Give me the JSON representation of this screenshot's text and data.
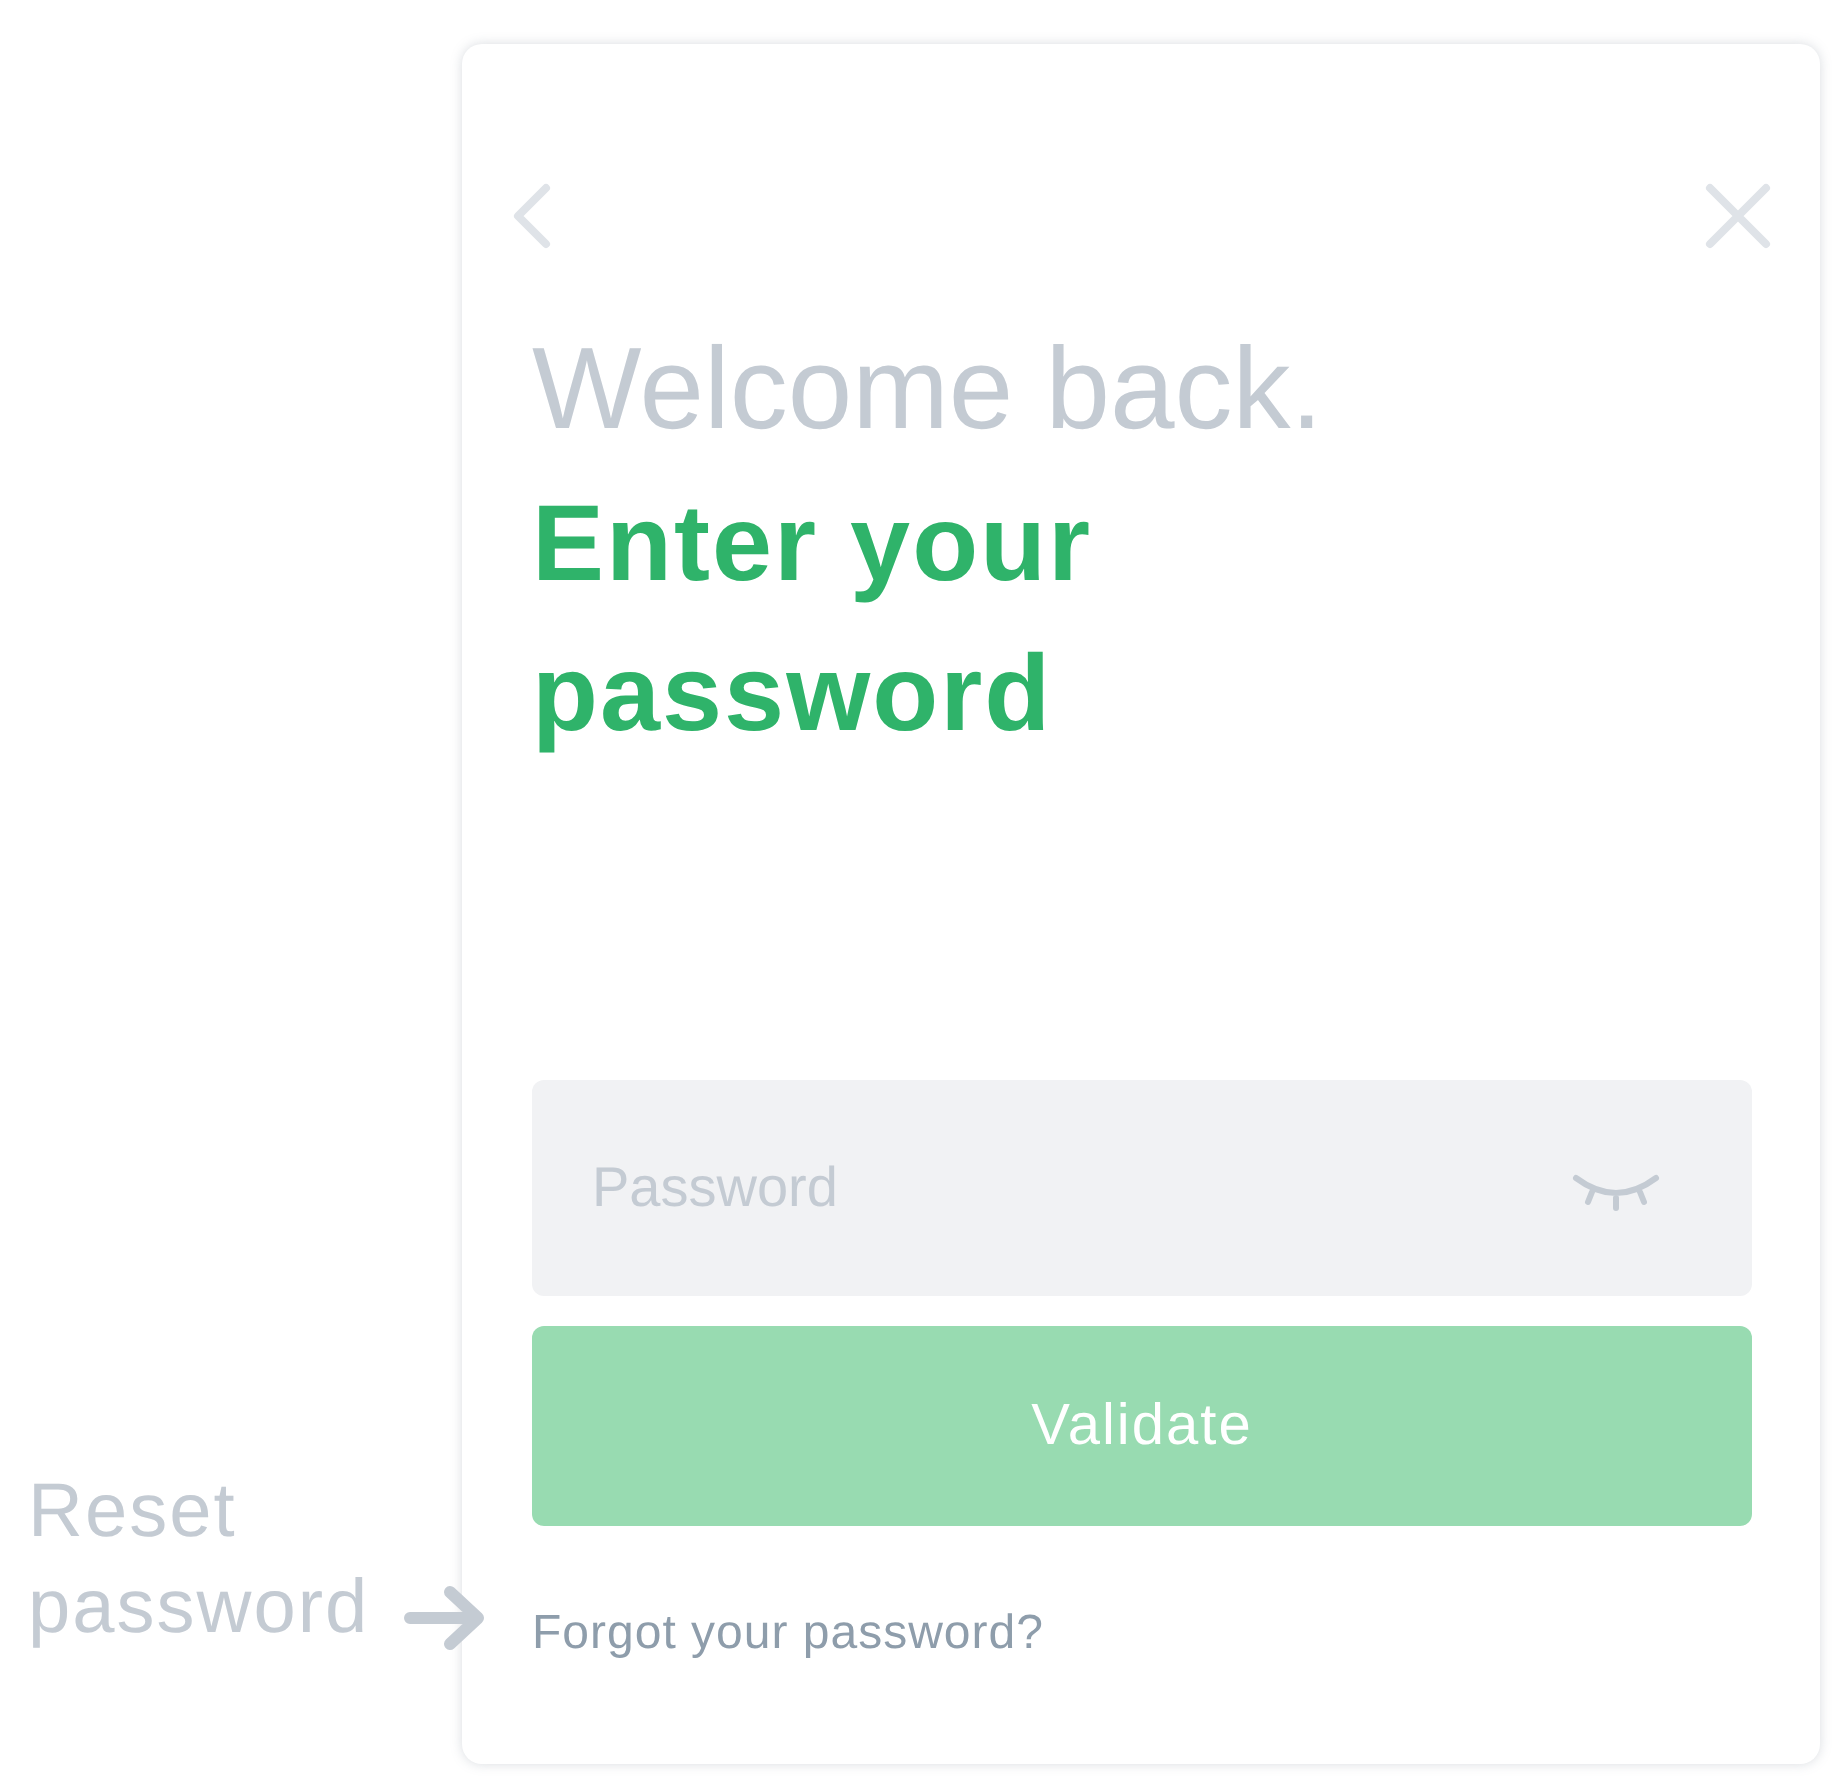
{
  "annotation": {
    "text": "Reset password"
  },
  "card": {
    "greeting": "Welcome back.",
    "heading": "Enter your password",
    "password_field": {
      "placeholder": "Password",
      "visible": false
    },
    "submit_button": {
      "label": "Validate",
      "disabled": true
    },
    "forgot_link": "Forgot your password?"
  }
}
